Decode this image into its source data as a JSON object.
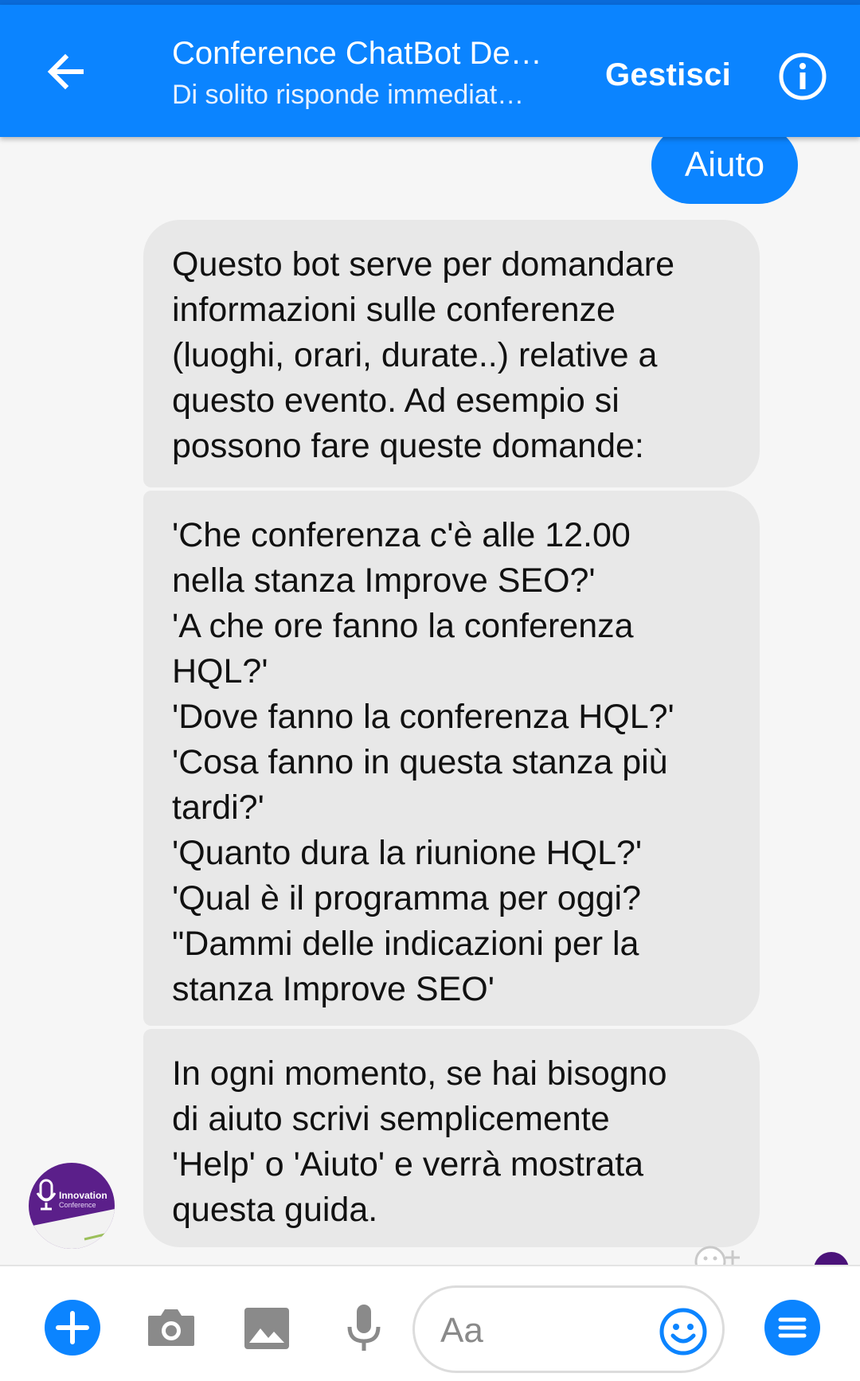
{
  "header": {
    "title": "Conference ChatBot De…",
    "subtitle": "Di solito risponde immediat…",
    "manage_label": "Gestisci"
  },
  "messages": {
    "user_message": "Aiuto",
    "bot_message_1": [
      "Questo bot serve per domandare",
      "informazioni sulle conferenze",
      "(luoghi, orari, durate..) relative a",
      "questo evento. Ad esempio si",
      "possono fare queste domande:"
    ],
    "bot_message_2": [
      "'Che conferenza c'è alle 12.00",
      "nella stanza Improve SEO?'",
      "'A che ore fanno la conferenza",
      "HQL?'",
      "'Dove fanno la conferenza HQL?'",
      "'Cosa fanno in questa stanza più",
      "tardi?'",
      "'Quanto dura la riunione HQL?'",
      "'Qual è il programma per oggi?",
      "\"Dammi delle indicazioni per la",
      "stanza Improve SEO'"
    ],
    "bot_message_3": [
      "In ogni momento, se hai bisogno",
      "di aiuto scrivi semplicemente",
      "'Help' o 'Aiuto' e verrà mostrata",
      "questa guida."
    ]
  },
  "avatar": {
    "line1": "Innovation",
    "line2": "Conference"
  },
  "composer": {
    "placeholder": "Aa"
  },
  "icons": {
    "back": "arrow-left-icon",
    "info": "info-icon",
    "plus": "plus-icon",
    "camera": "camera-icon",
    "photo": "photo-icon",
    "mic": "microphone-icon",
    "emoji": "smiley-icon",
    "menu": "menu-icon"
  },
  "colors": {
    "brand_blue": "#0b84ff",
    "bubble_gray": "#e8e8e8",
    "avatar_purple": "#5b1f8a"
  }
}
